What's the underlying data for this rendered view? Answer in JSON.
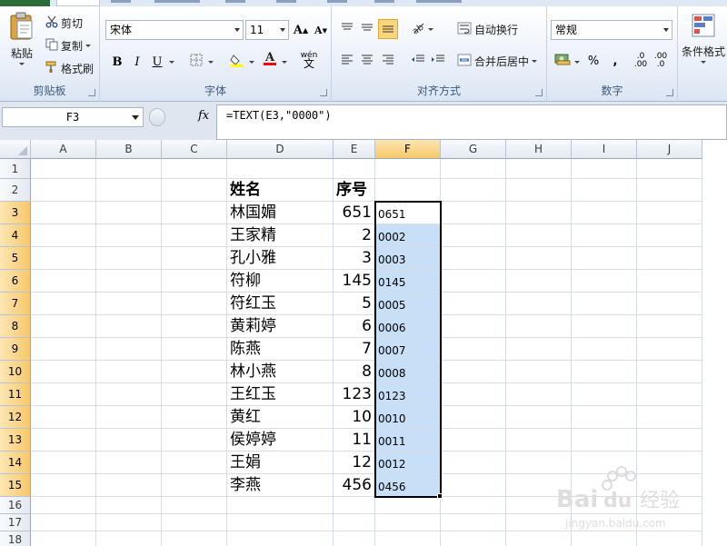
{
  "ribbon": {
    "clipboard": {
      "paste_label": "粘贴",
      "cut_label": "剪切",
      "copy_label": "复制",
      "format_painter_label": "格式刷",
      "group_label": "剪贴板"
    },
    "font": {
      "font_name": "宋体",
      "font_size": "11",
      "bold": "B",
      "italic": "I",
      "underline": "U",
      "grow_font": "A",
      "shrink_font": "A",
      "phonetic": "wén",
      "group_label": "字体"
    },
    "alignment": {
      "wrap_text_label": "自动换行",
      "merge_center_label": "合并后居中",
      "group_label": "对齐方式"
    },
    "number": {
      "format_value": "常规",
      "percent": "%",
      "comma": ",",
      "inc_decimal": ".0",
      "dec_decimal": ".00",
      "group_label": "数字"
    },
    "styles": {
      "conditional_format_label": "条件格式"
    }
  },
  "formula_bar": {
    "name_box": "F3",
    "fx_label": "fx",
    "formula": "=TEXT(E3,\"0000\")"
  },
  "columns": [
    "A",
    "B",
    "C",
    "D",
    "E",
    "F",
    "G",
    "H",
    "I",
    "J"
  ],
  "selected_column": "F",
  "rows": [
    "1",
    "2",
    "3",
    "4",
    "5",
    "6",
    "7",
    "8",
    "9",
    "10",
    "11",
    "12",
    "13",
    "14",
    "15",
    "16",
    "17",
    "18"
  ],
  "selected_rows": [
    "3",
    "4",
    "5",
    "6",
    "7",
    "8",
    "9",
    "10",
    "11",
    "12",
    "13",
    "14",
    "15"
  ],
  "headers": {
    "name": "姓名",
    "seq": "序号"
  },
  "data_rows": [
    {
      "name": "林国媚",
      "seq": "651",
      "text": "0651"
    },
    {
      "name": "王家精",
      "seq": "2",
      "text": "0002"
    },
    {
      "name": "孔小雅",
      "seq": "3",
      "text": "0003"
    },
    {
      "name": "符柳",
      "seq": "145",
      "text": "0145"
    },
    {
      "name": "符红玉",
      "seq": "5",
      "text": "0005"
    },
    {
      "name": "黄莉婷",
      "seq": "6",
      "text": "0006"
    },
    {
      "name": "陈燕",
      "seq": "7",
      "text": "0007"
    },
    {
      "name": "林小燕",
      "seq": "8",
      "text": "0008"
    },
    {
      "name": "王红玉",
      "seq": "123",
      "text": "0123"
    },
    {
      "name": "黄红",
      "seq": "10",
      "text": "0010"
    },
    {
      "name": "侯婷婷",
      "seq": "11",
      "text": "0011"
    },
    {
      "name": "王娟",
      "seq": "12",
      "text": "0012"
    },
    {
      "name": "李燕",
      "seq": "456",
      "text": "0456"
    }
  ],
  "colors": {
    "selection": "#c7dff7",
    "header_selected": "#f7c86a",
    "file_tab": "#2a6b38"
  },
  "watermark": "Bai du 经验 jingyan.baidu.com"
}
